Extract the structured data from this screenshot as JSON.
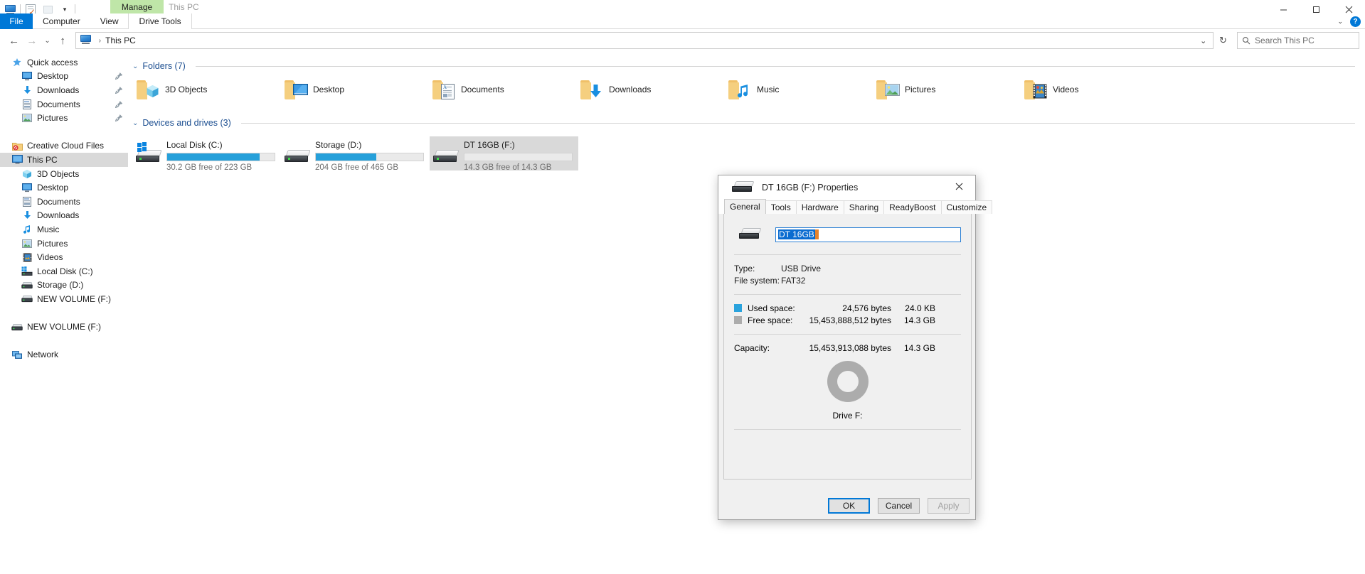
{
  "window": {
    "context_tab_group": "Manage",
    "title": "This PC",
    "quick_access_toolbar": [
      {
        "name": "this-pc-icon",
        "label": "This PC"
      },
      {
        "name": "properties-icon",
        "label": "Properties"
      },
      {
        "name": "new-folder-icon",
        "label": "New folder"
      },
      {
        "name": "customize-qat-chevron-icon",
        "label": "Customize Quick Access Toolbar"
      }
    ],
    "controls": {
      "minimize": "—",
      "maximize": "❐",
      "close": "✕"
    }
  },
  "ribbon": {
    "tabs": [
      {
        "label": "File",
        "active": false,
        "style": "file"
      },
      {
        "label": "Computer",
        "active": false,
        "style": "normal"
      },
      {
        "label": "View",
        "active": false,
        "style": "normal"
      },
      {
        "label": "Drive Tools",
        "active": true,
        "style": "contextual"
      }
    ],
    "collapse_chevron": "⌄",
    "help_label": "?"
  },
  "address_bar": {
    "back": "←",
    "forward": "→",
    "recent_chevron": "⌄",
    "up": "↑",
    "breadcrumb": [
      {
        "label": "This PC"
      }
    ],
    "separator": "›",
    "dropdown_chevron": "⌄",
    "refresh": "↻",
    "search_placeholder": "Search This PC",
    "search_value": "",
    "search_icon": "⌕"
  },
  "navigation_pane": {
    "items": [
      {
        "label": "Quick access",
        "icon": "star-icon",
        "indent": 0,
        "pinned": false,
        "selected": false
      },
      {
        "label": "Desktop",
        "icon": "desktop-icon",
        "indent": 1,
        "pinned": true,
        "selected": false
      },
      {
        "label": "Downloads",
        "icon": "downloads-icon",
        "indent": 1,
        "pinned": true,
        "selected": false
      },
      {
        "label": "Documents",
        "icon": "documents-icon",
        "indent": 1,
        "pinned": true,
        "selected": false
      },
      {
        "label": "Pictures",
        "icon": "pictures-icon",
        "indent": 1,
        "pinned": true,
        "selected": false
      },
      {
        "label": "",
        "icon": "spacer",
        "indent": 0,
        "pinned": false,
        "selected": false
      },
      {
        "label": "Creative Cloud Files",
        "icon": "creative-cloud-icon",
        "indent": 0,
        "pinned": false,
        "selected": false
      },
      {
        "label": "This PC",
        "icon": "this-pc-icon",
        "indent": 0,
        "pinned": false,
        "selected": true
      },
      {
        "label": "3D Objects",
        "icon": "3d-objects-icon",
        "indent": 1,
        "pinned": false,
        "selected": false
      },
      {
        "label": "Desktop",
        "icon": "desktop-icon",
        "indent": 1,
        "pinned": false,
        "selected": false
      },
      {
        "label": "Documents",
        "icon": "documents-icon",
        "indent": 1,
        "pinned": false,
        "selected": false
      },
      {
        "label": "Downloads",
        "icon": "downloads-icon",
        "indent": 1,
        "pinned": false,
        "selected": false
      },
      {
        "label": "Music",
        "icon": "music-icon",
        "indent": 1,
        "pinned": false,
        "selected": false
      },
      {
        "label": "Pictures",
        "icon": "pictures-icon",
        "indent": 1,
        "pinned": false,
        "selected": false
      },
      {
        "label": "Videos",
        "icon": "videos-icon",
        "indent": 1,
        "pinned": false,
        "selected": false
      },
      {
        "label": "Local Disk (C:)",
        "icon": "local-disk-icon",
        "indent": 1,
        "pinned": false,
        "selected": false
      },
      {
        "label": "Storage (D:)",
        "icon": "drive-icon",
        "indent": 1,
        "pinned": false,
        "selected": false
      },
      {
        "label": "NEW VOLUME (F:)",
        "icon": "drive-icon",
        "indent": 1,
        "pinned": false,
        "selected": false
      },
      {
        "label": "",
        "icon": "spacer",
        "indent": 0,
        "pinned": false,
        "selected": false
      },
      {
        "label": "NEW VOLUME (F:)",
        "icon": "drive-icon",
        "indent": 0,
        "pinned": false,
        "selected": false
      },
      {
        "label": "",
        "icon": "spacer",
        "indent": 0,
        "pinned": false,
        "selected": false
      },
      {
        "label": "Network",
        "icon": "network-icon",
        "indent": 0,
        "pinned": false,
        "selected": false
      }
    ]
  },
  "content": {
    "folders_group": {
      "chevron": "⌄",
      "title": "Folders (7)"
    },
    "folders": [
      {
        "label": "3D Objects",
        "icon": "folder-3d-objects-icon"
      },
      {
        "label": "Desktop",
        "icon": "folder-desktop-icon"
      },
      {
        "label": "Documents",
        "icon": "folder-documents-icon"
      },
      {
        "label": "Downloads",
        "icon": "folder-downloads-icon"
      },
      {
        "label": "Music",
        "icon": "folder-music-icon"
      },
      {
        "label": "Pictures",
        "icon": "folder-pictures-icon"
      },
      {
        "label": "Videos",
        "icon": "folder-videos-icon"
      }
    ],
    "drives_group": {
      "chevron": "⌄",
      "title": "Devices and drives (3)"
    },
    "drives": [
      {
        "name": "Local Disk (C:)",
        "sub": "30.2 GB free of 223 GB",
        "used_percent": 86,
        "selected": false,
        "icon": "windows-drive-icon"
      },
      {
        "name": "Storage (D:)",
        "sub": "204 GB free of 465 GB",
        "used_percent": 56,
        "selected": false,
        "icon": "drive-icon"
      },
      {
        "name": "DT 16GB (F:)",
        "sub": "14.3 GB free of 14.3 GB",
        "used_percent": 0,
        "selected": true,
        "icon": "usb-drive-icon"
      }
    ]
  },
  "dialog": {
    "title": "DT 16GB (F:) Properties",
    "close_label": "✕",
    "tabs": [
      {
        "label": "General",
        "active": true
      },
      {
        "label": "Tools",
        "active": false
      },
      {
        "label": "Hardware",
        "active": false
      },
      {
        "label": "Sharing",
        "active": false
      },
      {
        "label": "ReadyBoost",
        "active": false
      },
      {
        "label": "Customize",
        "active": false
      }
    ],
    "volume_name_value": "DT 16GB",
    "volume_name_selected": true,
    "fields": [
      {
        "key": "Type:",
        "value": "USB Drive"
      },
      {
        "key": "File system:",
        "value": "FAT32"
      }
    ],
    "space": [
      {
        "label": "Used space:",
        "bytes": "24,576 bytes",
        "human": "24.0 KB",
        "color": "#2aa3dd"
      },
      {
        "label": "Free space:",
        "bytes": "15,453,888,512 bytes",
        "human": "14.3 GB",
        "color": "#acacac"
      }
    ],
    "capacity": {
      "label": "Capacity:",
      "bytes": "15,453,913,088 bytes",
      "human": "14.3 GB"
    },
    "drive_caption": "Drive F:",
    "buttons": [
      {
        "label": "OK",
        "state": "default"
      },
      {
        "label": "Cancel",
        "state": "normal"
      },
      {
        "label": "Apply",
        "state": "disabled"
      }
    ]
  },
  "chart_data": {
    "type": "pie",
    "title": "Drive F:",
    "labels": [
      "Used space",
      "Free space"
    ],
    "values": [
      24576,
      15453888512
    ],
    "percents": [
      0.00016,
      99.99984
    ],
    "colors": [
      "#2aa3dd",
      "#acacac"
    ],
    "units": "bytes",
    "total": 15453913088,
    "legend": "left",
    "annotations": [
      "Used space: 24,576 bytes / 24.0 KB",
      "Free space: 15,453,888,512 bytes / 14.3 GB",
      "Capacity: 15,453,913,088 bytes / 14.3 GB"
    ]
  }
}
